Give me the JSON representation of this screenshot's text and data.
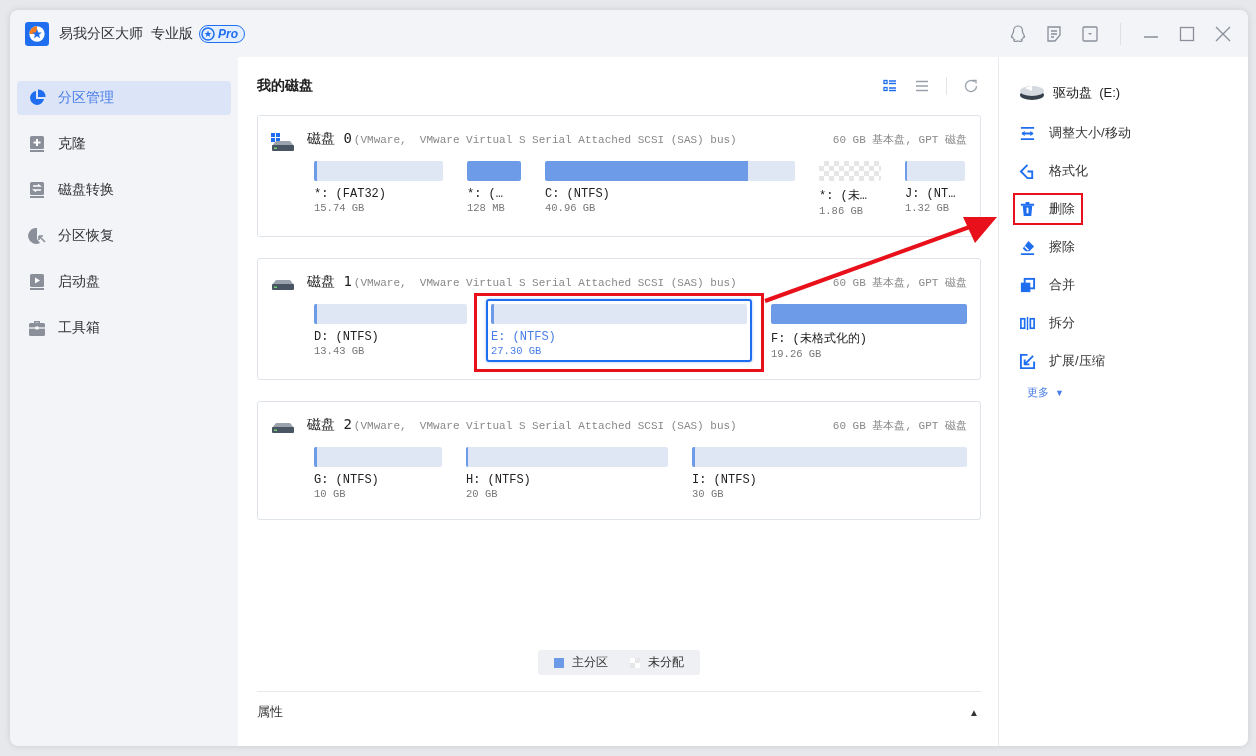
{
  "window": {
    "app_name": "易我分区大师",
    "edition": "专业版",
    "badge": "Pro"
  },
  "sidebar": {
    "items": [
      {
        "label": "分区管理",
        "kind": "pie",
        "selected": true
      },
      {
        "label": "克隆",
        "kind": "clone",
        "selected": false
      },
      {
        "label": "磁盘转换",
        "kind": "convert",
        "selected": false
      },
      {
        "label": "分区恢复",
        "kind": "recover",
        "selected": false
      },
      {
        "label": "启动盘",
        "kind": "boot",
        "selected": false
      },
      {
        "label": "工具箱",
        "kind": "toolbox",
        "selected": false
      }
    ]
  },
  "main": {
    "title": "我的磁盘",
    "views": [
      {
        "kind": "grid",
        "selected": true
      },
      {
        "kind": "list",
        "selected": false
      }
    ]
  },
  "disks": [
    {
      "name": "磁盘 0",
      "system": true,
      "model": "(VMware,  VMware Virtual S Serial Attached SCSI (SAS) bus)",
      "info": "60 GB 基本盘, GPT 磁盘",
      "partitions": [
        {
          "label": "*: (FAT32)",
          "size": "15.74 GB",
          "kind": "primary",
          "level": 0.02,
          "selected": false,
          "highlighted": false
        },
        {
          "label": "*: (…",
          "size": "128 MB",
          "kind": "primary",
          "level": 1,
          "selected": false,
          "highlighted": false
        },
        {
          "label": "C: (NTFS)",
          "size": "40.96 GB",
          "kind": "primary",
          "level": 0.81,
          "selected": false,
          "highlighted": false
        },
        {
          "label": "*: (未…",
          "size": "1.86 GB",
          "kind": "unallocated",
          "selected": false,
          "highlighted": false
        },
        {
          "label": "J: (NT…",
          "size": "1.32 GB",
          "kind": "primary",
          "level": 0.03,
          "selected": false,
          "highlighted": false
        }
      ]
    },
    {
      "name": "磁盘 1",
      "system": false,
      "model": "(VMware,  VMware Virtual S Serial Attached SCSI (SAS) bus)",
      "info": "60 GB 基本盘, GPT 磁盘",
      "partitions": [
        {
          "label": "D: (NTFS)",
          "size": "13.43 GB",
          "kind": "primary",
          "level": 0.02,
          "selected": false,
          "highlighted": false
        },
        {
          "label": "E: (NTFS)",
          "size": "27.30 GB",
          "kind": "primary",
          "level": 0.01,
          "selected": true,
          "highlighted": true
        },
        {
          "label": "F: (未格式化的)",
          "size": "19.26 GB",
          "kind": "primary",
          "level": 1,
          "selected": false,
          "highlighted": false
        }
      ]
    },
    {
      "name": "磁盘 2",
      "system": false,
      "model": "(VMware,  VMware Virtual S Serial Attached SCSI (SAS) bus)",
      "info": "60 GB 基本盘, GPT 磁盘",
      "partitions": [
        {
          "label": "G: (NTFS)",
          "size": "10 GB",
          "kind": "primary",
          "level": 0.02,
          "selected": false,
          "highlighted": false
        },
        {
          "label": "H: (NTFS)",
          "size": "20 GB",
          "kind": "primary",
          "level": 0.01,
          "selected": false,
          "highlighted": false
        },
        {
          "label": "I: (NTFS)",
          "size": "30 GB",
          "kind": "primary",
          "level": 0.01,
          "selected": false,
          "highlighted": false
        }
      ]
    }
  ],
  "legend": [
    {
      "label": "主分区",
      "kind": "primary"
    },
    {
      "label": "未分配",
      "kind": "unallocated"
    }
  ],
  "properties": {
    "title": "属性",
    "toggle": "▲"
  },
  "actions": {
    "drive": "驱动盘  (E:)",
    "items": [
      {
        "label": "调整大小/移动",
        "kind": "resize",
        "highlighted": false
      },
      {
        "label": "格式化",
        "kind": "format",
        "highlighted": false
      },
      {
        "label": "删除",
        "kind": "delete",
        "highlighted": true
      },
      {
        "label": "擦除",
        "kind": "wipe",
        "highlighted": false
      },
      {
        "label": "合并",
        "kind": "merge",
        "highlighted": false
      },
      {
        "label": "拆分",
        "kind": "split",
        "highlighted": false
      },
      {
        "label": "扩展/压缩",
        "kind": "extend",
        "highlighted": false
      }
    ],
    "more": "更多",
    "more_caret": "▼"
  }
}
